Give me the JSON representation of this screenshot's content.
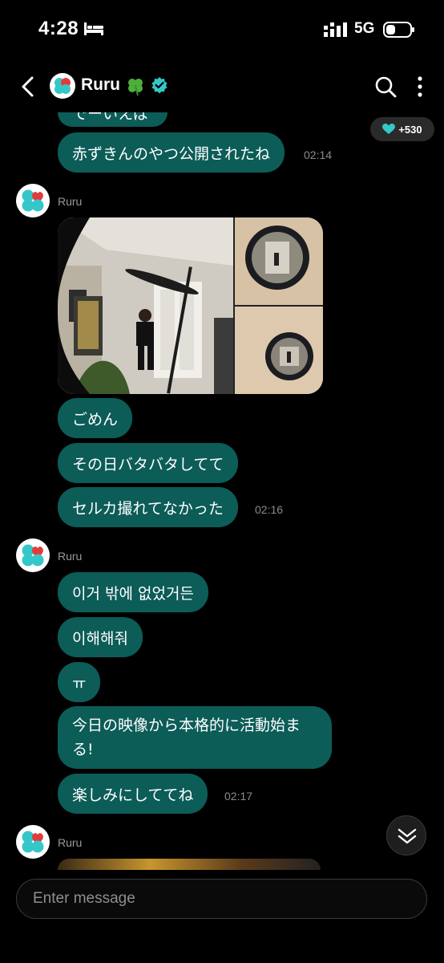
{
  "status_bar": {
    "time": "4:28",
    "network": "5G"
  },
  "header": {
    "name": "Ruru"
  },
  "hearts": {
    "count": "+530"
  },
  "messages": {
    "partial_top": "でーいえば",
    "m1": {
      "text": "赤ずきんのやつ公開されたね",
      "time": "02:14"
    },
    "group2_sender": "Ruru",
    "m2": {
      "text": "ごめん"
    },
    "m3": {
      "text": "その日バタバタしてて"
    },
    "m4": {
      "text": "セルカ撮れてなかった",
      "time": "02:16"
    },
    "group3_sender": "Ruru",
    "m5": {
      "text": "이거 밖에 없었거든"
    },
    "m6": {
      "text": "이해해줘"
    },
    "m7": {
      "text": "ㅠ"
    },
    "m8": {
      "text": "今日の映像から本格的に活動始まる!"
    },
    "m9": {
      "text": "楽しみにしててね",
      "time": "02:17"
    },
    "group4_sender": "Ruru"
  },
  "input": {
    "placeholder": "Enter message"
  },
  "colors": {
    "bubble": "#0c5c58",
    "accent": "#35c7c7",
    "background": "#000000"
  }
}
